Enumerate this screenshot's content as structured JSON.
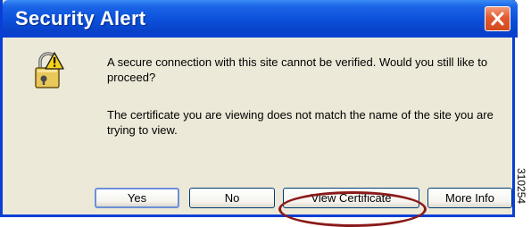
{
  "window": {
    "title": "Security Alert"
  },
  "icons": {
    "close": "close-icon",
    "alert": "security-lock-warning-icon"
  },
  "messages": {
    "primary": "A secure connection with this site cannot be verified. Would you still like to proceed?",
    "secondary": "The certificate you are viewing does not match the name of the site you are trying to view."
  },
  "buttons": {
    "yes": "Yes",
    "no": "No",
    "view_certificate": "View Certificate",
    "more_info": "More Info"
  },
  "figure_id": "310254",
  "colors": {
    "titlebar": "#0a4fd9",
    "close_button": "#e2592f",
    "dialog_background": "#ece9d8",
    "highlight_ring": "#8b1a1a"
  }
}
